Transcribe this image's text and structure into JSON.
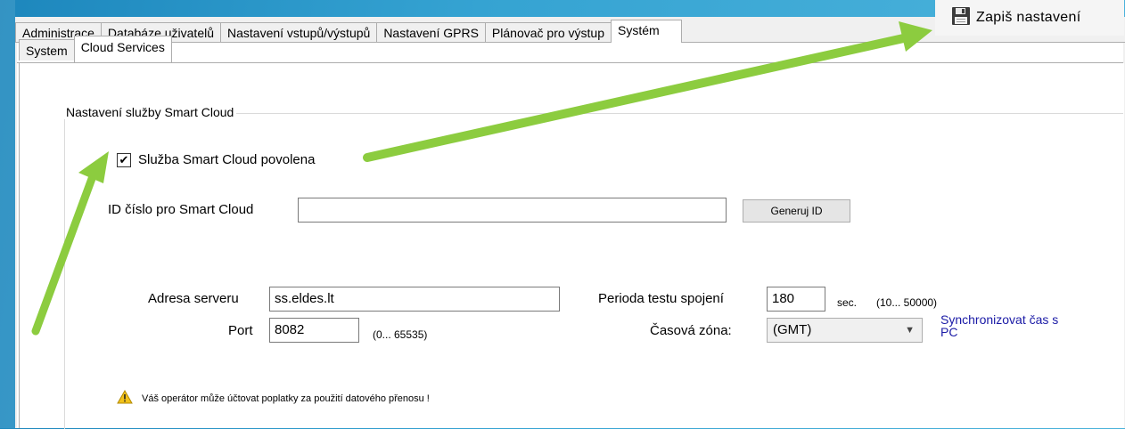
{
  "tabs": [
    "Administrace",
    "Databáze uživatelů",
    "Nastavení vstupů/výstupů",
    "Nastavení GPRS",
    "Plánovač pro výstup",
    "Systém"
  ],
  "active_tab": "Systém",
  "save_button": {
    "label": "Zapiš nastavení",
    "icon": "floppy-disk-icon"
  },
  "subtabs": [
    "System",
    "Cloud Services"
  ],
  "active_subtab": "Cloud Services",
  "group": {
    "title": "Nastavení služby Smart Cloud",
    "checkbox_label": "Služba Smart Cloud povolena",
    "checkbox_checked": true,
    "id_label": "ID číslo pro Smart Cloud",
    "id_value": "",
    "generate_button": "Generuj ID",
    "server_label": "Adresa serveru",
    "server_value": "ss.eldes.lt",
    "port_label": "Port",
    "port_value": "8082",
    "port_range": "(0... 65535)",
    "period_label": "Perioda testu spojení",
    "period_value": "180",
    "period_unit": "sec.",
    "period_range": "(10... 50000)",
    "timezone_label": "Časová zóna:",
    "timezone_value": "(GMT)",
    "sync_link_line1": "Synchronizovat čas s",
    "sync_link_line2": "PC",
    "warning_text": "Váš operátor může účtovat poplatky za použití datového přenosu !"
  },
  "colors": {
    "arrow": "#8ccc3f",
    "background": "#2f9dcf",
    "link": "#1a1aa6"
  }
}
